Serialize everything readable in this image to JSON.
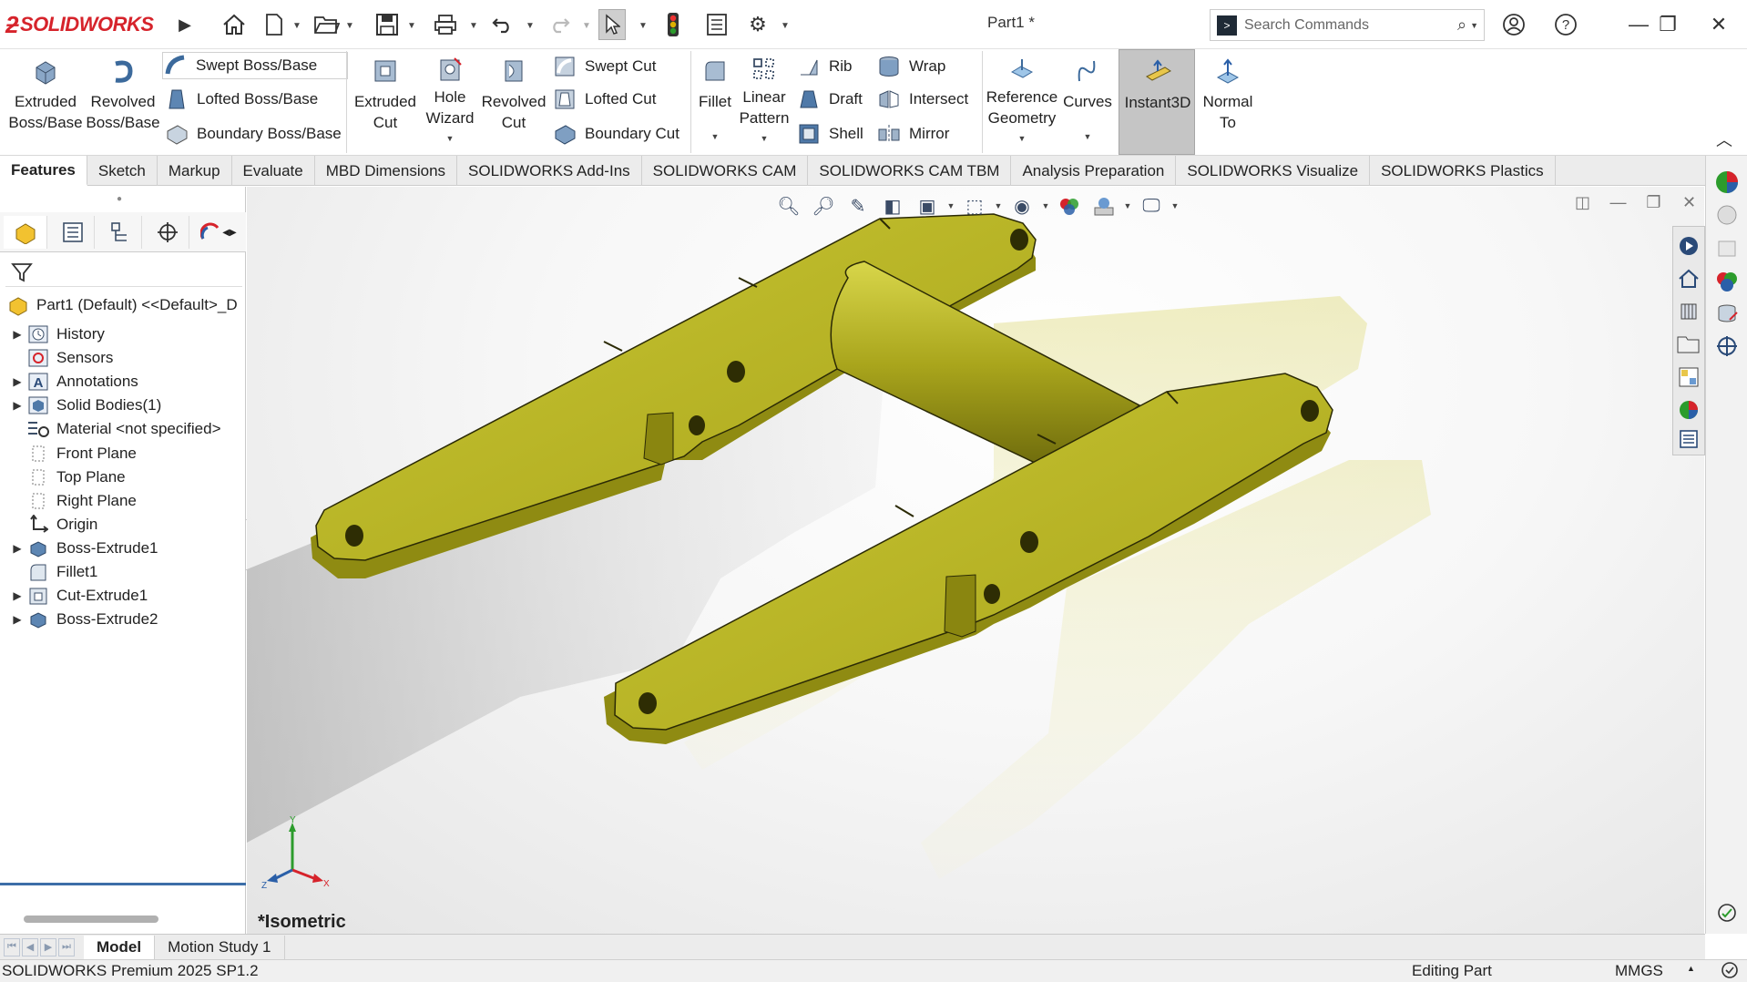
{
  "app": {
    "brand": "SOLIDWORKS",
    "document_title": "Part1 *"
  },
  "search": {
    "placeholder": "Search Commands"
  },
  "ribbon": {
    "extruded_boss": "Extruded\nBoss/Base",
    "revolved_boss": "Revolved\nBoss/Base",
    "swept_boss": "Swept Boss/Base",
    "lofted_boss": "Lofted Boss/Base",
    "boundary_boss": "Boundary Boss/Base",
    "extruded_cut": "Extruded\nCut",
    "hole_wizard": "Hole\nWizard",
    "revolved_cut": "Revolved\nCut",
    "swept_cut": "Swept Cut",
    "lofted_cut": "Lofted Cut",
    "boundary_cut": "Boundary Cut",
    "fillet": "Fillet",
    "linear_pattern": "Linear\nPattern",
    "rib": "Rib",
    "draft": "Draft",
    "shell": "Shell",
    "wrap": "Wrap",
    "intersect": "Intersect",
    "mirror": "Mirror",
    "reference_geometry": "Reference\nGeometry",
    "curves": "Curves",
    "instant3d": "Instant3D",
    "normal_to": "Normal\nTo"
  },
  "tabs": [
    "Features",
    "Sketch",
    "Markup",
    "Evaluate",
    "MBD Dimensions",
    "SOLIDWORKS Add-Ins",
    "SOLIDWORKS CAM",
    "SOLIDWORKS CAM TBM",
    "Analysis Preparation",
    "SOLIDWORKS Visualize",
    "SOLIDWORKS Plastics"
  ],
  "tree": {
    "root": "Part1 (Default) <<Default>_D",
    "items": [
      {
        "label": "History",
        "expandable": true
      },
      {
        "label": "Sensors",
        "expandable": false
      },
      {
        "label": "Annotations",
        "expandable": true
      },
      {
        "label": "Solid Bodies(1)",
        "expandable": true
      },
      {
        "label": "Material <not specified>",
        "expandable": false
      },
      {
        "label": "Front Plane",
        "expandable": false
      },
      {
        "label": "Top Plane",
        "expandable": false
      },
      {
        "label": "Right Plane",
        "expandable": false
      },
      {
        "label": "Origin",
        "expandable": false
      },
      {
        "label": "Boss-Extrude1",
        "expandable": true
      },
      {
        "label": "Fillet1",
        "expandable": false
      },
      {
        "label": "Cut-Extrude1",
        "expandable": true
      },
      {
        "label": "Boss-Extrude2",
        "expandable": true
      }
    ]
  },
  "viewport": {
    "view_name": "*Isometric",
    "axis_x": "X",
    "axis_y": "Y",
    "axis_z": "Z",
    "part_color": "#b3b122"
  },
  "bottom_tabs": [
    "Model",
    "Motion Study 1"
  ],
  "status": {
    "product": "SOLIDWORKS Premium 2025 SP1.2",
    "mode": "Editing Part",
    "units": "MMGS"
  }
}
